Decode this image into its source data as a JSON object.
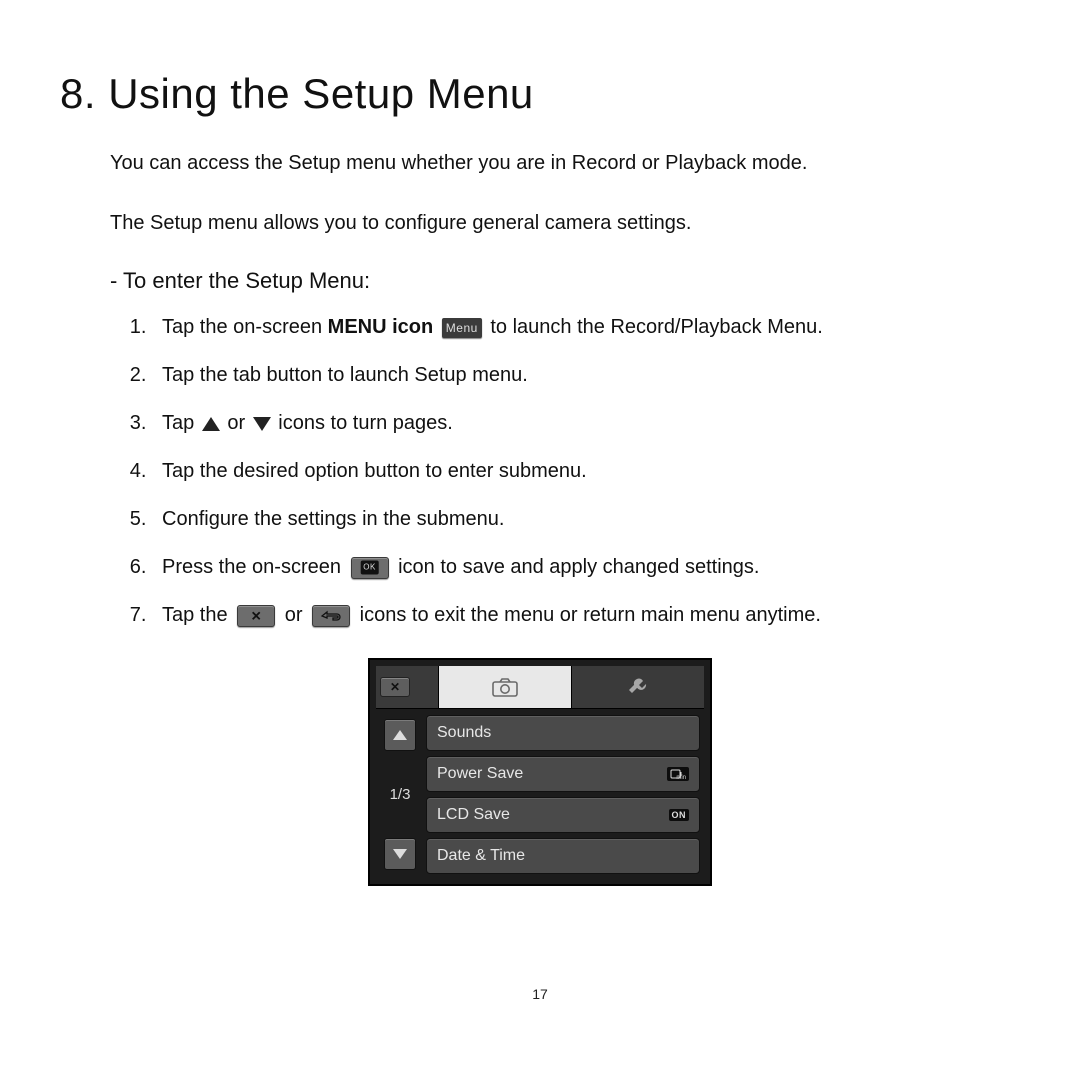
{
  "heading": "8. Using the Setup Menu",
  "intro1": "You can access the Setup menu whether you are in Record or Playback mode.",
  "intro2": "The Setup menu allows you to configure general camera settings.",
  "subheading": "- To enter the Setup Menu:",
  "steps": {
    "s1a": "Tap the on-screen ",
    "s1b": "MENU icon",
    "s1c": " to launch the Record/Playback Menu.",
    "s2": "Tap the tab button to launch Setup menu.",
    "s3a": "Tap ",
    "s3b": " or ",
    "s3c": " icons to turn pages.",
    "s4": "Tap the desired option button to enter submenu.",
    "s5": "Configure the settings in the submenu.",
    "s6a": "Press the on-screen ",
    "s6b": " icon to save and apply changed settings.",
    "s7a": "Tap the ",
    "s7b": " or ",
    "s7c": " icons to exit the menu or return main menu anytime."
  },
  "inline": {
    "menu": "Menu",
    "ok": "OK"
  },
  "device": {
    "page": "1/3",
    "rows": {
      "r1": "Sounds",
      "r2": "Power Save",
      "r2badge": "min",
      "r3": "LCD Save",
      "r3badge": "ON",
      "r4": "Date & Time"
    }
  },
  "pagenum": "17"
}
